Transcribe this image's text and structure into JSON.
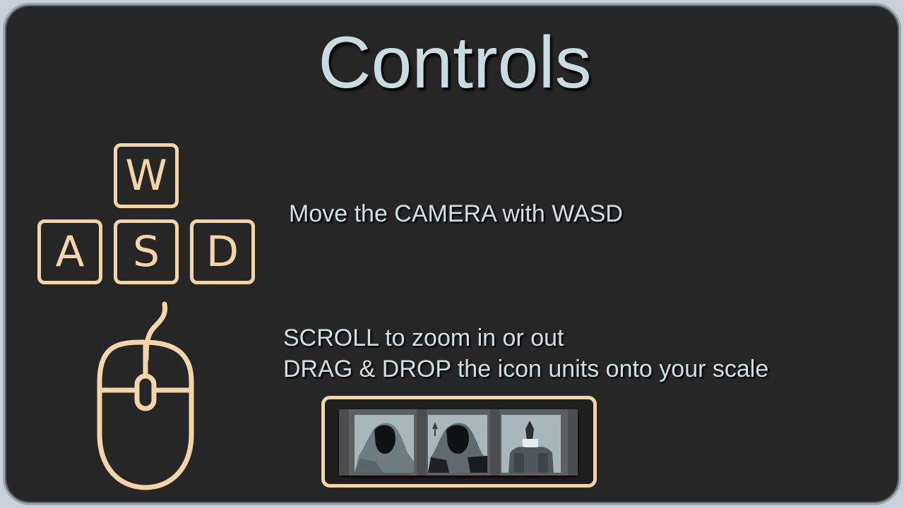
{
  "title": "Controls",
  "keys": {
    "up": "W",
    "left": "A",
    "down": "S",
    "right": "D"
  },
  "camera_text": "Move the CAMERA with WASD",
  "scroll_text": "SCROLL to zoom in or out",
  "drag_text": "DRAG & DROP the icon units onto your scale",
  "icons": {
    "keyboard": "wasd-keys",
    "mouse": "mouse-icon",
    "units": [
      "hooded-unit-icon",
      "hooded-unit-upgraded-icon",
      "armored-unit-icon"
    ]
  },
  "colors": {
    "accent": "#f3d6a8",
    "text": "#cfe0e4",
    "background": "#262626"
  }
}
